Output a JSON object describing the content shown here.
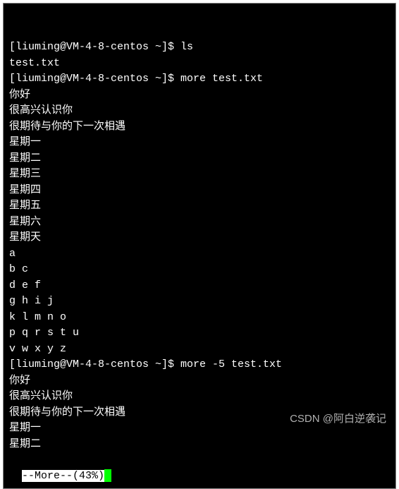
{
  "terminal": {
    "lines": [
      {
        "text": "[liuming@VM-4-8-centos ~]$ ls",
        "type": "prompt"
      },
      {
        "text": "test.txt",
        "type": "output"
      },
      {
        "text": "[liuming@VM-4-8-centos ~]$ more test.txt",
        "type": "prompt"
      },
      {
        "text": "你好",
        "type": "output"
      },
      {
        "text": "很高兴认识你",
        "type": "output"
      },
      {
        "text": "很期待与你的下一次相遇",
        "type": "output"
      },
      {
        "text": "星期一",
        "type": "output"
      },
      {
        "text": "星期二",
        "type": "output"
      },
      {
        "text": "星期三",
        "type": "output"
      },
      {
        "text": "星期四",
        "type": "output"
      },
      {
        "text": "星期五",
        "type": "output"
      },
      {
        "text": "星期六",
        "type": "output"
      },
      {
        "text": "星期天",
        "type": "output"
      },
      {
        "text": "a",
        "type": "output"
      },
      {
        "text": "b c",
        "type": "output"
      },
      {
        "text": "d e f",
        "type": "output"
      },
      {
        "text": "g h i j",
        "type": "output"
      },
      {
        "text": "k l m n o",
        "type": "output"
      },
      {
        "text": "p q r s t u",
        "type": "output"
      },
      {
        "text": "v w x y z",
        "type": "output"
      },
      {
        "text": "[liuming@VM-4-8-centos ~]$ more -5 test.txt",
        "type": "prompt"
      },
      {
        "text": "你好",
        "type": "output"
      },
      {
        "text": "很高兴认识你",
        "type": "output"
      },
      {
        "text": "很期待与你的下一次相遇",
        "type": "output"
      },
      {
        "text": "星期一",
        "type": "output"
      },
      {
        "text": "星期二",
        "type": "output"
      }
    ],
    "more_status": "--More--(43%)"
  },
  "watermark": "CSDN @阿白逆袭记"
}
